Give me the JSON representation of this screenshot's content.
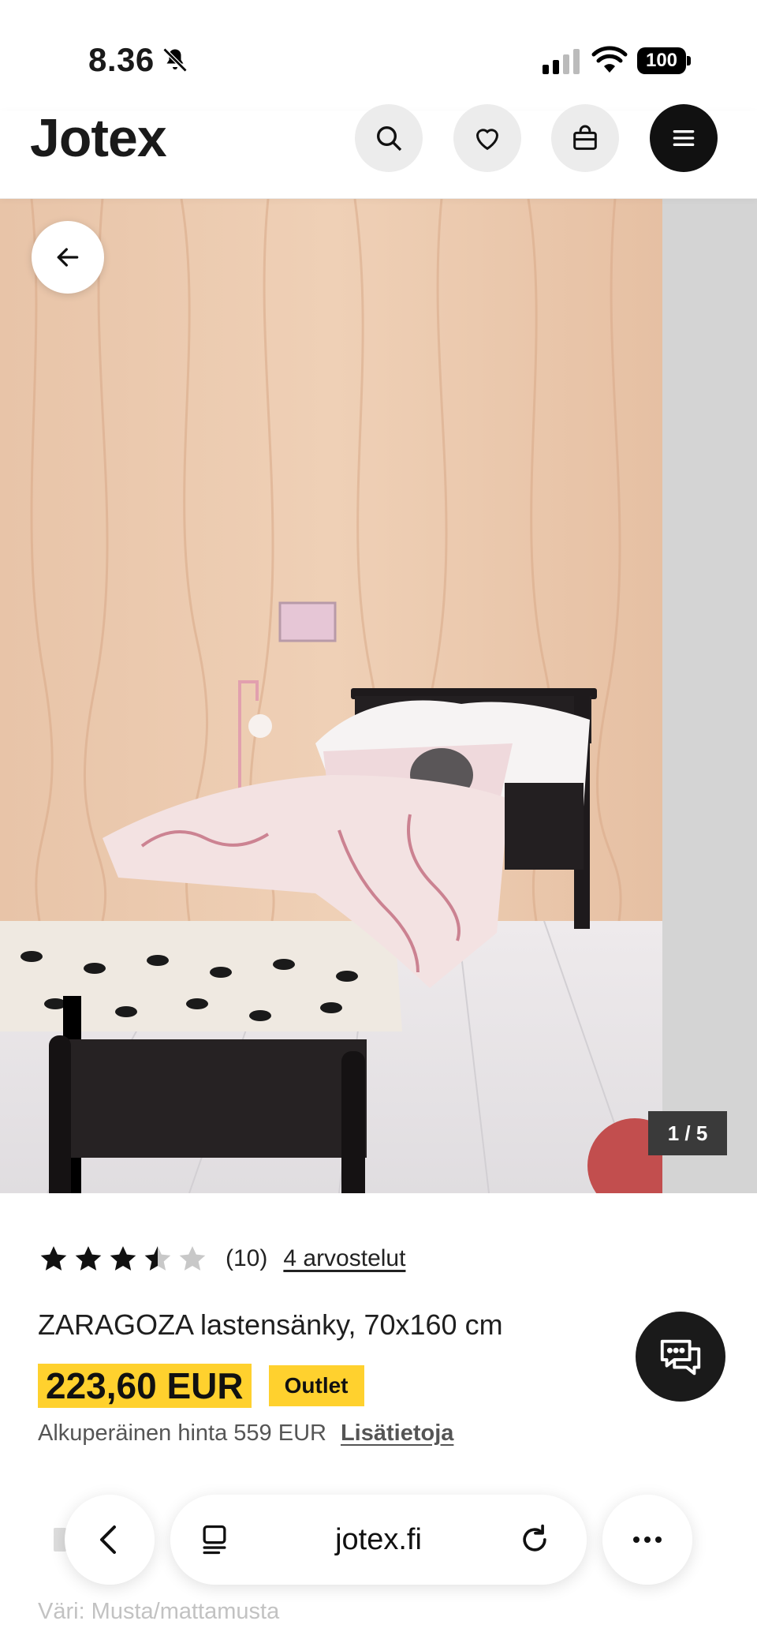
{
  "status_bar": {
    "time": "8.36",
    "battery": "100"
  },
  "header": {
    "logo": "Jotex",
    "icons": [
      "search-icon",
      "heart-icon",
      "bag-icon",
      "menu-icon"
    ]
  },
  "gallery": {
    "counter": "1 / 5"
  },
  "product": {
    "rating_value": 3.5,
    "rating_max": 5,
    "rating_count": "(10)",
    "reviews_link": "4 arvostelut",
    "title": "ZARAGOZA lastensänky, 70x160 cm",
    "price": "223,60 EUR",
    "badge": "Outlet",
    "original_price": "Alkuperäinen hinta 559 EUR",
    "more_info": "Lisätietoja",
    "color": "Väri: Musta/mattamusta"
  },
  "browser": {
    "url": "jotex.fi"
  },
  "colors": {
    "accent": "#ffd12e",
    "dark": "#111111"
  }
}
